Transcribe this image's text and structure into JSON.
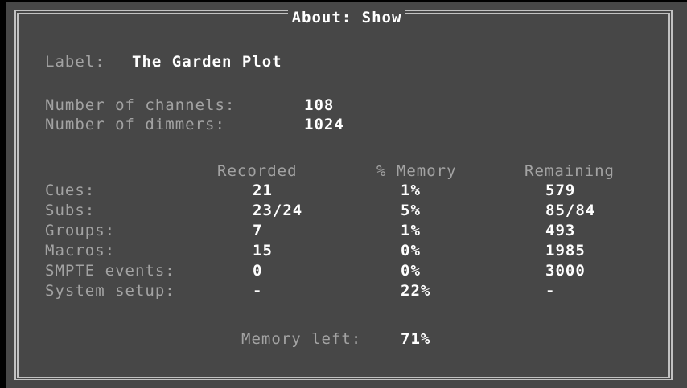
{
  "window": {
    "title": "About: Show"
  },
  "show": {
    "label_caption": "Label:",
    "label_value": "The Garden Plot"
  },
  "counts": {
    "channels_caption": "Number of channels:",
    "channels_value": "108",
    "dimmers_caption": "Number of dimmers:",
    "dimmers_value": "1024"
  },
  "table": {
    "headers": [
      "Recorded",
      "% Memory",
      "Remaining"
    ],
    "rows": [
      {
        "label": "Cues:",
        "recorded": "21",
        "memory": "1%",
        "remaining": "579"
      },
      {
        "label": "Subs:",
        "recorded": "23/24",
        "memory": "5%",
        "remaining": "85/84"
      },
      {
        "label": "Groups:",
        "recorded": "7",
        "memory": "1%",
        "remaining": "493"
      },
      {
        "label": "Macros:",
        "recorded": "15",
        "memory": "0%",
        "remaining": "1985"
      },
      {
        "label": "SMPTE events:",
        "recorded": "0",
        "memory": "0%",
        "remaining": "3000"
      },
      {
        "label": "System setup:",
        "recorded": "-",
        "memory": "22%",
        "remaining": "-"
      }
    ]
  },
  "memory": {
    "caption": "Memory left:",
    "value": "71%"
  },
  "colors": {
    "background": "#474747",
    "border": "#c2c2c2",
    "dim_text": "#a3a3a3",
    "value_text": "#ffffff"
  }
}
